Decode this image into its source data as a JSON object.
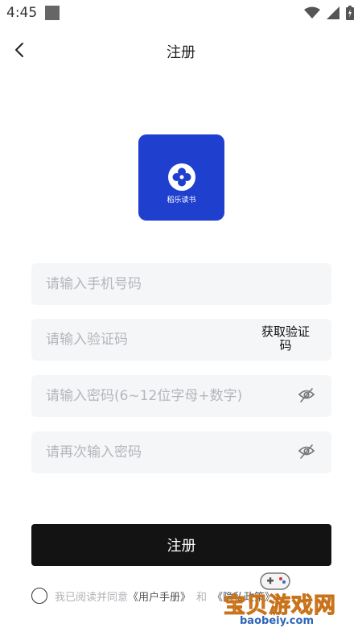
{
  "status_bar": {
    "time": "4:45",
    "icons": [
      "square-icon",
      "wifi-icon",
      "signal-icon",
      "battery-icon"
    ]
  },
  "nav": {
    "back_icon": "chevron-left-icon",
    "title": "注册"
  },
  "logo": {
    "caption": "稻乐读书",
    "color": "#1f40cf"
  },
  "form": {
    "phone_placeholder": "请输入手机号码",
    "code_placeholder": "请输入验证码",
    "get_code_label": "获取验证码",
    "password_placeholder": "请输入密码(6~12位字母+数字)",
    "confirm_placeholder": "请再次输入密码",
    "visibility_icon": "eye-off-icon",
    "submit_label": "注册"
  },
  "agreement": {
    "checked": false,
    "prefix": "我已阅读并同意",
    "user_manual": "《用户手册》",
    "and": "和",
    "privacy": "《隐私政策》"
  },
  "watermark": {
    "text": "宝贝游戏网",
    "url": "baobeiy.com"
  }
}
